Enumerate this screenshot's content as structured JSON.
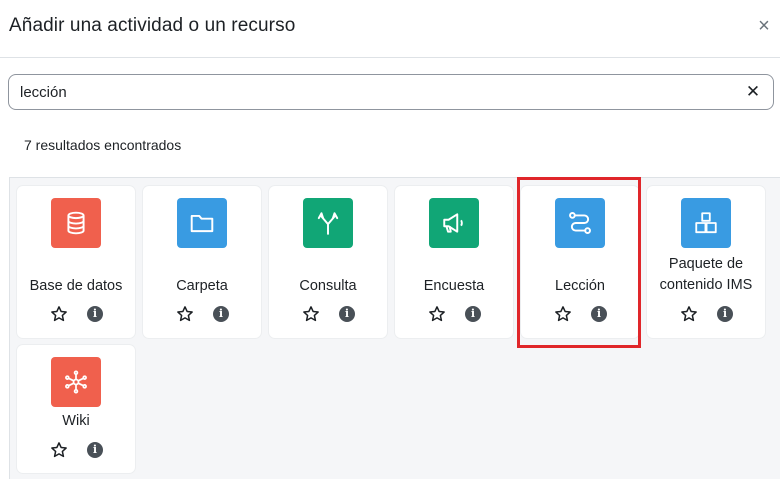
{
  "modal": {
    "title": "Añadir una actividad o un recurso",
    "close_glyph": "×"
  },
  "search": {
    "value": "lección",
    "clear_glyph": "✕"
  },
  "results": {
    "count_text": "7 resultados encontrados"
  },
  "cards": [
    {
      "label": "Base de datos",
      "icon": "database-icon",
      "color": "#f0604d"
    },
    {
      "label": "Carpeta",
      "icon": "folder-icon",
      "color": "#399be2"
    },
    {
      "label": "Consulta",
      "icon": "signpost-icon",
      "color": "#11a676"
    },
    {
      "label": "Encuesta",
      "icon": "megaphone-icon",
      "color": "#11a676"
    },
    {
      "label": "Lección",
      "icon": "lesson-path-icon",
      "color": "#399be2"
    },
    {
      "label": "Paquete de contenido IMS",
      "icon": "package-boxes-icon",
      "color": "#399be2"
    },
    {
      "label": "Wiki",
      "icon": "wiki-network-icon",
      "color": "#f0604d"
    }
  ],
  "card_actions": {
    "star_icon": "star-icon",
    "info_glyph": "i"
  },
  "highlight_color": "#e0262a"
}
